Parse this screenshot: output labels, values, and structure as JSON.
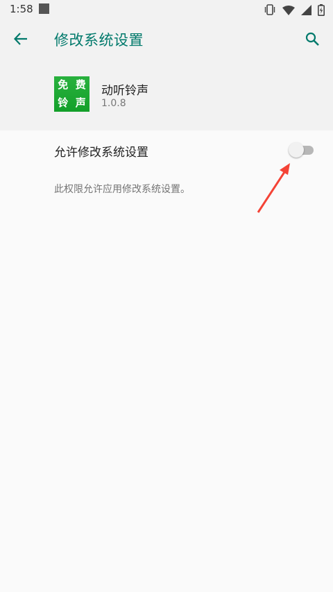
{
  "status_bar": {
    "time": "1:58",
    "icons": [
      "notification-square-icon",
      "vibrate-icon",
      "wifi-icon",
      "signal-icon",
      "battery-charging-icon"
    ]
  },
  "app_bar": {
    "title": "修改系统设置",
    "back_icon": "arrow-left-icon",
    "search_icon": "search-icon",
    "accent_color": "#00796b"
  },
  "app_info": {
    "name": "动听铃声",
    "version": "1.0.8",
    "icon_text": [
      "免",
      "费",
      "铃",
      "声"
    ],
    "icon_color": "#1aa632"
  },
  "setting": {
    "label": "允许修改系统设置",
    "enabled": false,
    "description": "此权限允许应用修改系统设置。"
  },
  "annotation": {
    "arrow_color": "#f44336"
  }
}
